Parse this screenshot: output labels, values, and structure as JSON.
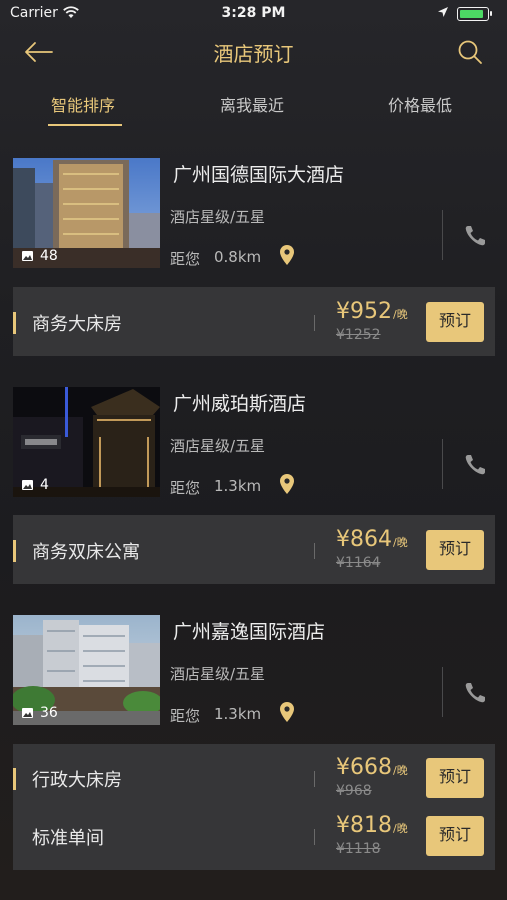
{
  "status": {
    "carrier": "Carrier",
    "time": "3:28 PM"
  },
  "nav": {
    "title": "酒店预订"
  },
  "tabs": [
    "智能排序",
    "离我最近",
    "价格最低"
  ],
  "colors": {
    "accent": "#e8c77a",
    "background": "#1f1f22",
    "room_panel": "#363638"
  },
  "battery_level": 0.75,
  "hotels": [
    {
      "name": "广州国德国际大酒店",
      "star": "酒店星级/五星",
      "dist_label": "距您",
      "distance": "0.8km",
      "photo_count": "48",
      "rooms": [
        {
          "name": "商务大床房",
          "price": "¥952",
          "per": "/晚",
          "orig": "¥1252",
          "book": "预订"
        }
      ]
    },
    {
      "name": "广州威珀斯酒店",
      "star": "酒店星级/五星",
      "dist_label": "距您",
      "distance": "1.3km",
      "photo_count": "4",
      "rooms": [
        {
          "name": "商务双床公寓",
          "price": "¥864",
          "per": "/晚",
          "orig": "¥1164",
          "book": "预订"
        }
      ]
    },
    {
      "name": "广州嘉逸国际酒店",
      "star": "酒店星级/五星",
      "dist_label": "距您",
      "distance": "1.3km",
      "photo_count": "36",
      "rooms": [
        {
          "name": "行政大床房",
          "price": "¥668",
          "per": "/晚",
          "orig": "¥968",
          "book": "预订"
        },
        {
          "name": "标准单间",
          "price": "¥818",
          "per": "/晚",
          "orig": "¥1118",
          "book": "预订"
        }
      ]
    }
  ]
}
